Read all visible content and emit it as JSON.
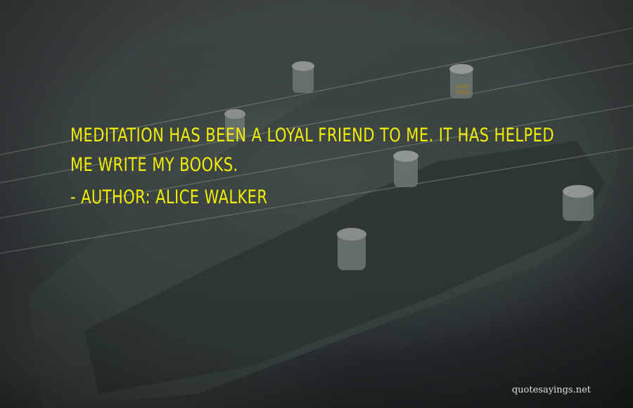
{
  "quote": {
    "text": "Meditation has been a loyal friend to me. It has helped me write my books.",
    "attribution_prefix": "- Author:",
    "author": "Alice Walker"
  },
  "watermark": {
    "text": "quotesayings.net"
  },
  "colors": {
    "quote_text": "#f2ee00",
    "background": "#2b3233",
    "watermark": "#ffffff"
  }
}
